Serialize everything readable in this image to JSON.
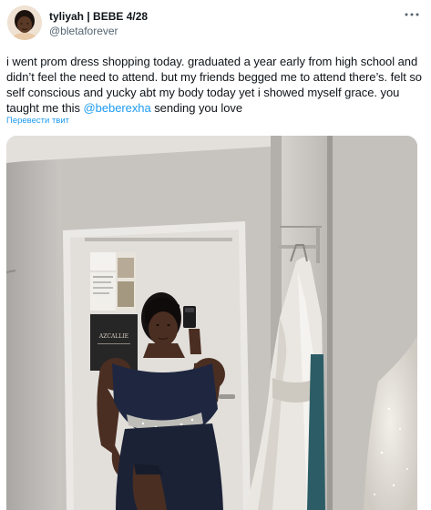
{
  "author": {
    "display_name": "tyliyah | BEBE 4/28",
    "handle": "@bletaforever"
  },
  "tweet": {
    "text_before_mention": "i went prom dress shopping today. graduated a year early from high school and didn’t feel the need to attend. but my friends begged me to attend there’s. felt so self conscious and yucky abt my body today yet i showed myself grace. you taught me this ",
    "mention": "@beberexha",
    "text_after_mention": " sending you love",
    "translate_label": "Перевести твит"
  },
  "poster_text": "AZCALLIE",
  "colors": {
    "link": "#1d9bf0",
    "text": "#0f1419",
    "secondary_text": "#536471",
    "dress": "#1f2740"
  },
  "icons": {
    "more": "more-dots-icon"
  }
}
